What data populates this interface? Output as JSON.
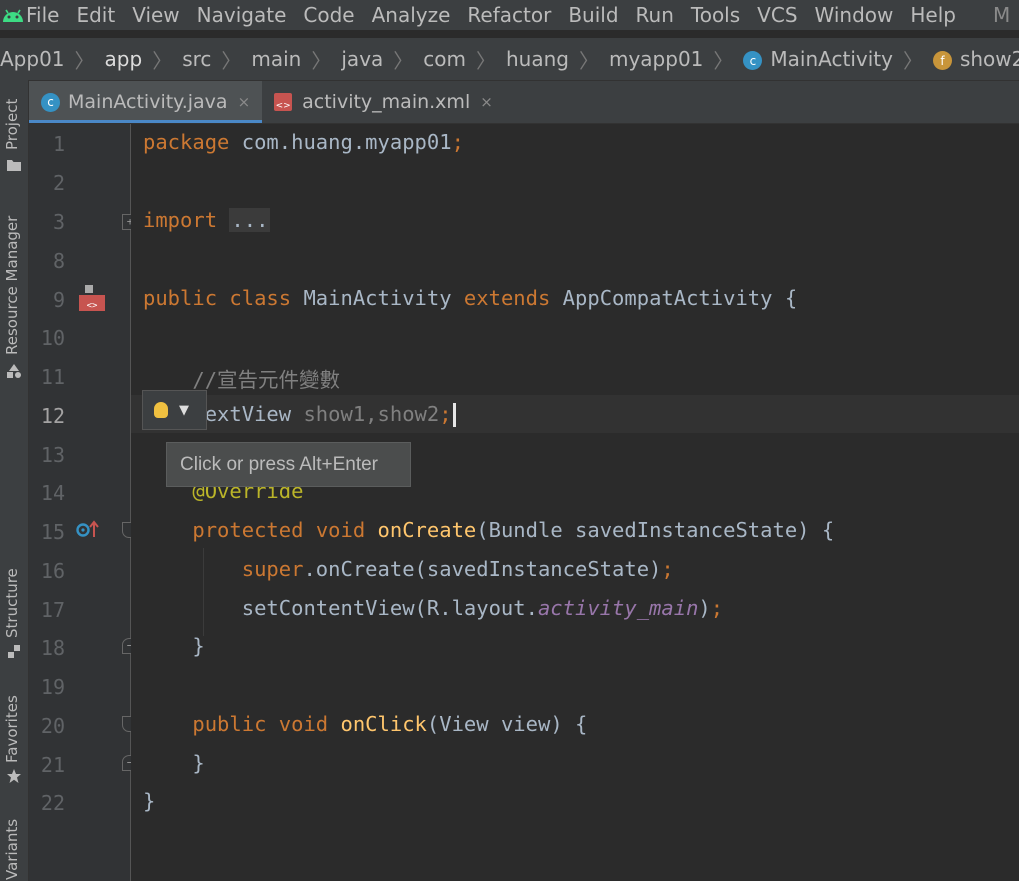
{
  "menubar": {
    "items": [
      "File",
      "Edit",
      "View",
      "Navigate",
      "Code",
      "Analyze",
      "Refactor",
      "Build",
      "Run",
      "Tools",
      "VCS",
      "Window",
      "Help"
    ],
    "trailing": "M"
  },
  "breadcrumb": {
    "items": [
      "App01",
      "app",
      "src",
      "main",
      "java",
      "com",
      "huang",
      "myapp01",
      "MainActivity",
      "show2"
    ],
    "run_config": "app"
  },
  "toolstrip": {
    "project": "Project",
    "resource_manager": "Resource Manager",
    "structure": "Structure",
    "favorites": "Favorites",
    "variants": "Variants"
  },
  "tabs": [
    {
      "label": "MainActivity.java",
      "close": "×"
    },
    {
      "label": "activity_main.xml",
      "close": "×"
    }
  ],
  "editor": {
    "line_numbers": [
      "1",
      "2",
      "3",
      "8",
      "9",
      "10",
      "11",
      "12",
      "13",
      "14",
      "15",
      "16",
      "17",
      "18",
      "19",
      "20",
      "21",
      "22"
    ],
    "current_line": "12",
    "code": {
      "package_kw": "package",
      "package_name": " com.huang.myapp01",
      "semicolon": ";",
      "import_kw": "import",
      "import_fold": "...",
      "public": "public",
      "class": "class",
      "class_name": "MainActivity",
      "extends": "extends",
      "super_class": "AppCompatActivity",
      "open_brace": " {",
      "comment": "//宣告元件變數",
      "textview_type": "TextView",
      "fields": " show1,show2",
      "override": "@Override",
      "protected": "protected",
      "void": "void",
      "oncreate": "onCreate",
      "oncreate_params": "(Bundle savedInstanceState) {",
      "super_kw": "super",
      "super_call": ".onCreate(savedInstanceState)",
      "setcontent": "setContentView(R.layout.",
      "layout_field": "activity_main",
      "close_paren": ")",
      "close_brace": "}",
      "onclick": "onClick",
      "onclick_params": "(View view) {"
    }
  },
  "tooltip": {
    "text": "Click or press Alt+Enter"
  },
  "colors": {
    "keyword": "#cc7832",
    "method": "#ffc66d",
    "comment": "#808080",
    "annotation": "#bbb529",
    "field": "#9876aa",
    "accent": "#4a88c7"
  }
}
